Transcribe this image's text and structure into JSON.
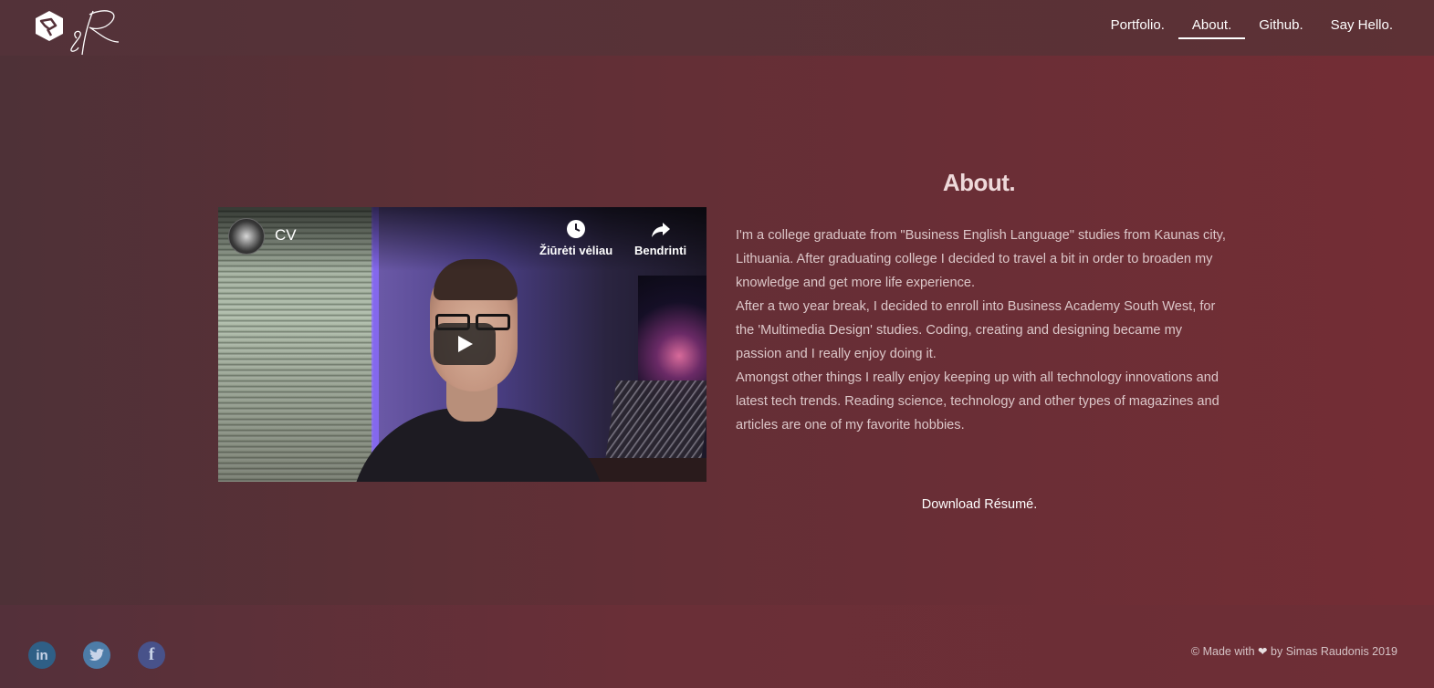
{
  "header": {
    "logo_icon": "hexagon-bird-logo",
    "logo_text": "sR",
    "nav": [
      {
        "label": "Portfolio.",
        "active": false
      },
      {
        "label": "About.",
        "active": true
      },
      {
        "label": "Github.",
        "active": false
      },
      {
        "label": "Say Hello.",
        "active": false
      }
    ]
  },
  "video": {
    "title": "CV",
    "watch_later": "Žiūrėti vėliau",
    "share": "Bendrinti",
    "icons": {
      "watch_later": "clock-icon",
      "share": "share-arrow-icon",
      "play": "play-icon"
    }
  },
  "about": {
    "title": "About.",
    "paragraphs": [
      "I'm a college graduate from \"Business English Language\" studies from Kaunas city, Lithuania. After graduating college I decided to travel a bit in order to broaden my knowledge and get more life experience.",
      "After a two year break, I decided to enroll into Business Academy South West, for the 'Multimedia Design' studies. Coding, creating and designing became my passion and I really enjoy doing it.",
      "Amongst other things I really enjoy keeping up with all technology innovations and latest tech trends. Reading science, technology and other types of magazines and articles are one of my favorite hobbies."
    ],
    "download_label": "Download Résumé."
  },
  "footer": {
    "social": [
      {
        "name": "linkedin",
        "glyph": "in"
      },
      {
        "name": "twitter",
        "glyph": "twitter-bird"
      },
      {
        "name": "facebook",
        "glyph": "f"
      }
    ],
    "copyright_prefix": "© Made with",
    "copyright_suffix": "by Simas Raudonis 2019"
  },
  "colors": {
    "background_start": "#4e3137",
    "background_end": "#742d35",
    "text": "#dcc7c9",
    "heading": "#eed9da"
  }
}
